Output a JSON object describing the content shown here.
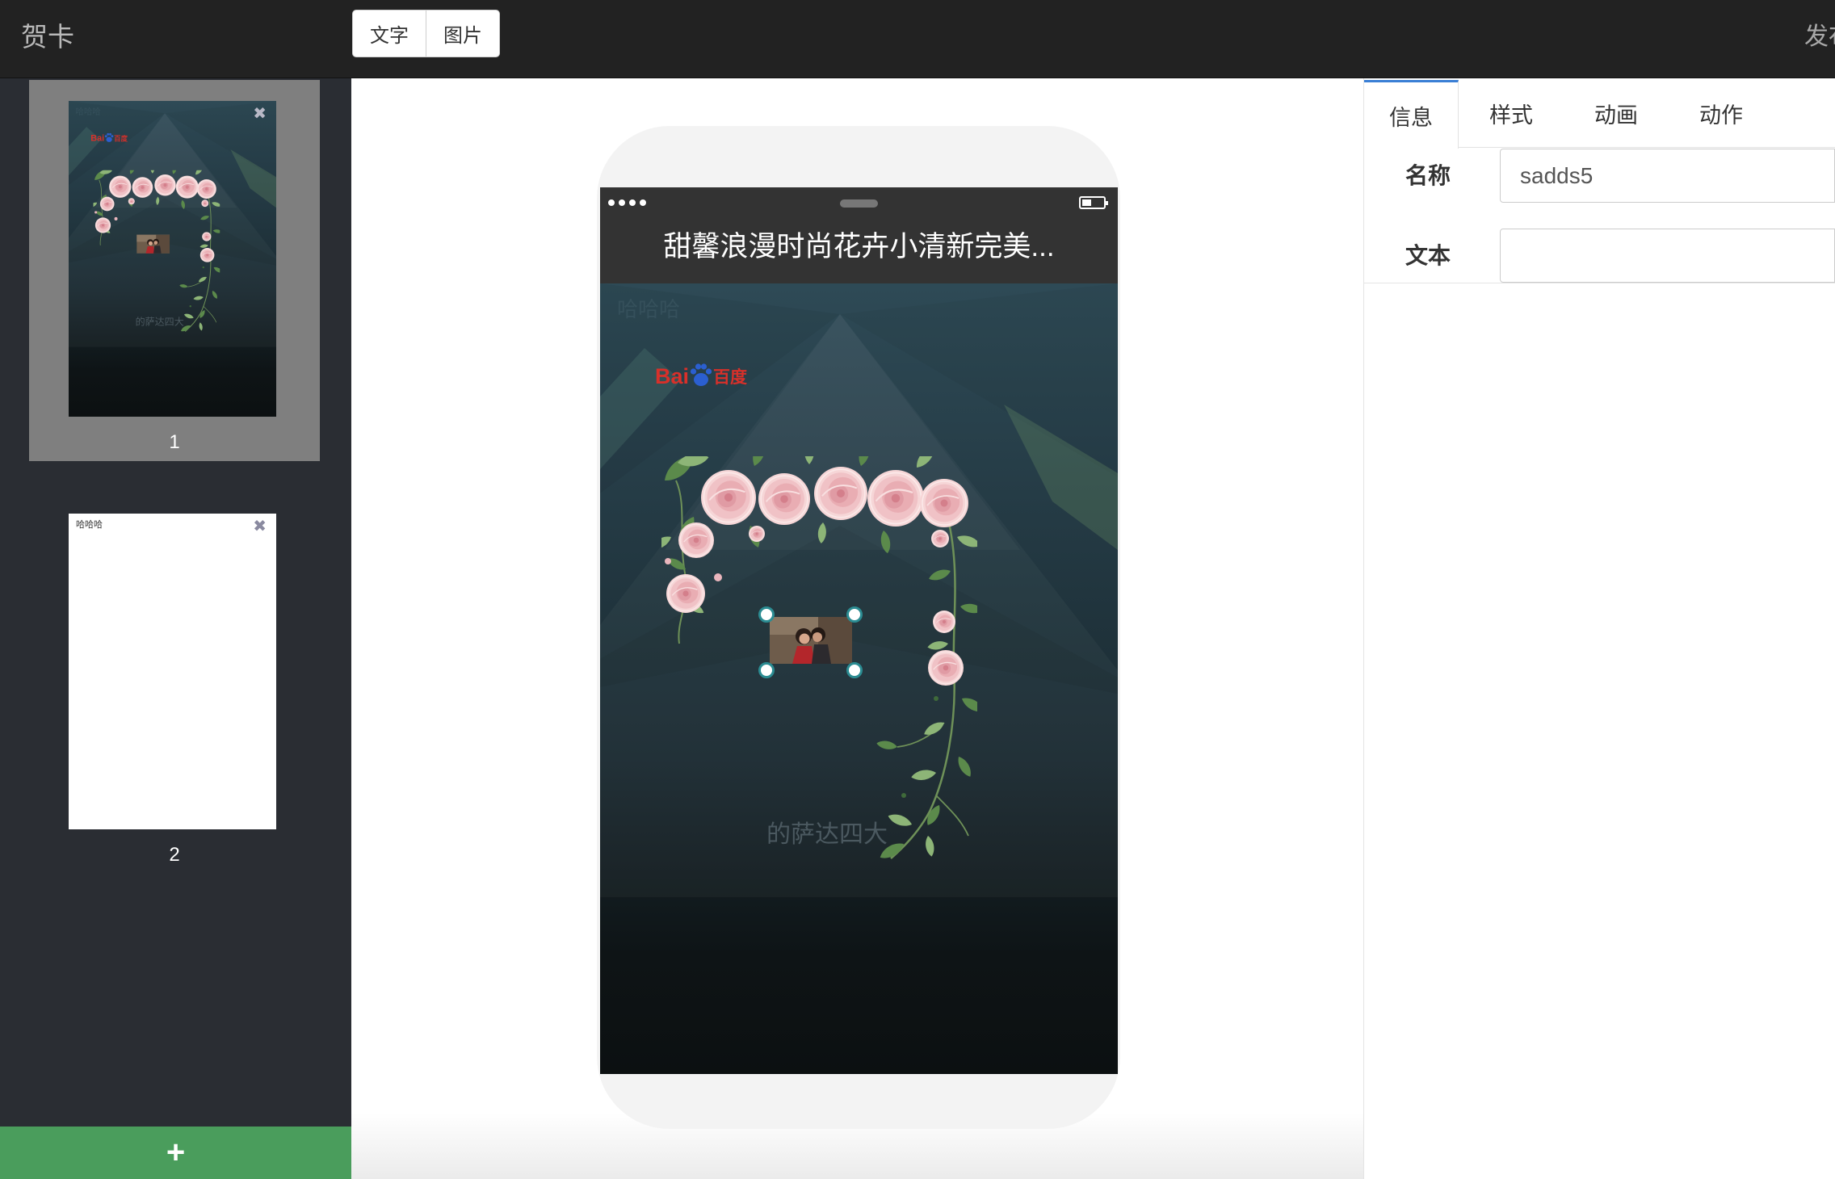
{
  "app": {
    "title": "贺卡",
    "publish_label": "发布"
  },
  "toolbar": {
    "buttons": [
      {
        "label": "文字"
      },
      {
        "label": "图片"
      }
    ]
  },
  "icons": {
    "close": "✖",
    "add": "+"
  },
  "slides": [
    {
      "number": "1",
      "selected": true
    },
    {
      "number": "2",
      "selected": false,
      "text": "哈哈哈"
    }
  ],
  "phone": {
    "title": "甜馨浪漫时尚花卉小清新完美..."
  },
  "page": {
    "faint_text": "哈哈哈",
    "logo": {
      "left": "Bai",
      "right": "百度"
    },
    "caption": "的萨达四大",
    "selected_element": "photo"
  },
  "panel": {
    "tabs": [
      {
        "label": "信息"
      },
      {
        "label": "样式"
      },
      {
        "label": "动画"
      },
      {
        "label": "动作"
      }
    ],
    "active_tab": "信息",
    "fields": [
      {
        "label": "名称",
        "value": "sadds5"
      },
      {
        "label": "文本",
        "value": ""
      }
    ]
  },
  "colors": {
    "header_bg": "#222222",
    "sidebar_bg": "#2a2d33",
    "selected_slide_bg": "#7f7f7f",
    "add_button_bg": "#4a9d5c",
    "active_tab_accent": "#3a7fd5",
    "selection_handle": "#2b8c92"
  }
}
